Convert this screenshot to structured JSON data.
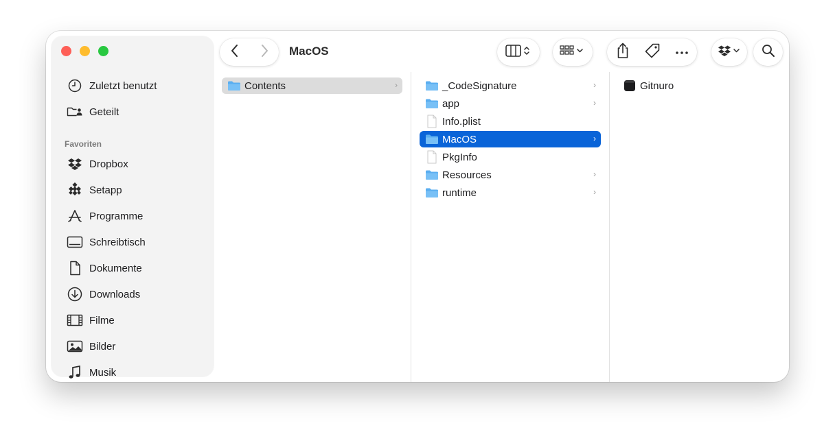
{
  "window": {
    "title": "MacOS"
  },
  "sidebar": {
    "recent": [
      {
        "label": "Zuletzt benutzt",
        "icon": "clock-icon"
      },
      {
        "label": "Geteilt",
        "icon": "shared-folder-icon"
      }
    ],
    "favorites_header": "Favoriten",
    "favorites": [
      {
        "label": "Dropbox",
        "icon": "dropbox-icon"
      },
      {
        "label": "Setapp",
        "icon": "setapp-icon"
      },
      {
        "label": "Programme",
        "icon": "applications-icon"
      },
      {
        "label": "Schreibtisch",
        "icon": "desktop-icon"
      },
      {
        "label": "Dokumente",
        "icon": "document-icon"
      },
      {
        "label": "Downloads",
        "icon": "download-icon"
      },
      {
        "label": "Filme",
        "icon": "film-icon"
      },
      {
        "label": "Bilder",
        "icon": "photo-icon"
      },
      {
        "label": "Musik",
        "icon": "music-icon"
      }
    ]
  },
  "toolbar": {
    "back": "back-icon",
    "forward": "forward-icon",
    "view_mode": "columns-view-icon",
    "group": "group-icon",
    "share": "share-icon",
    "tag": "tag-icon",
    "more": "more-icon",
    "dropbox": "dropbox-icon",
    "search": "search-icon"
  },
  "columns": [
    {
      "items": [
        {
          "name": "Contents",
          "type": "folder",
          "state": "parent-selected",
          "has_children": true
        }
      ]
    },
    {
      "items": [
        {
          "name": "_CodeSignature",
          "type": "folder",
          "has_children": true
        },
        {
          "name": "app",
          "type": "folder",
          "has_children": true
        },
        {
          "name": "Info.plist",
          "type": "file",
          "has_children": false
        },
        {
          "name": "MacOS",
          "type": "folder",
          "state": "selected",
          "has_children": true
        },
        {
          "name": "PkgInfo",
          "type": "file",
          "has_children": false
        },
        {
          "name": "Resources",
          "type": "folder",
          "has_children": true
        },
        {
          "name": "runtime",
          "type": "folder",
          "has_children": true
        }
      ]
    },
    {
      "items": [
        {
          "name": "Gitnuro",
          "type": "executable",
          "has_children": false
        }
      ]
    }
  ],
  "colors": {
    "selection": "#0a64d8",
    "folder": "#5aaef0",
    "red": "#fe5f57",
    "yellow": "#febc2e",
    "green": "#28c840"
  }
}
